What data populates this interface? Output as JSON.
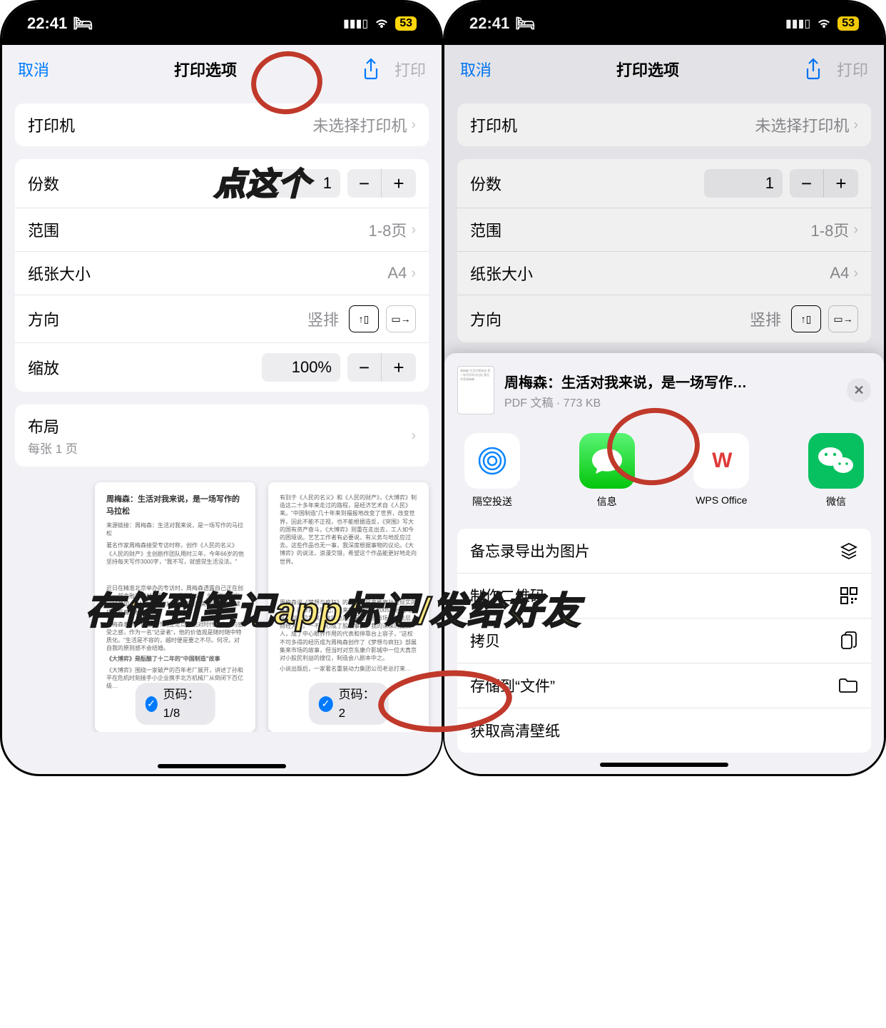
{
  "status": {
    "time": "22:41",
    "battery": "53"
  },
  "nav": {
    "cancel": "取消",
    "title": "打印选项",
    "print": "打印"
  },
  "rows": {
    "printer_label": "打印机",
    "printer_value": "未选择打印机",
    "copies_label": "份数",
    "copies_value": "1",
    "range_label": "范围",
    "range_value": "1-8页",
    "paper_label": "纸张大小",
    "paper_value": "A4",
    "orient_label": "方向",
    "orient_value": "竖排",
    "scale_label": "缩放",
    "scale_value": "100%",
    "layout_label": "布局",
    "layout_sub": "每张 1 页"
  },
  "preview": {
    "title": "周梅森：生活对我来说，是一场写作的马拉松",
    "sub1": "来源链接：周梅森：生活对我来说，是一场写作的马拉松",
    "badge1": "页码：1/8",
    "badge2": "页码：2"
  },
  "sheet": {
    "file_title": "周梅森：生活对我来说，是一场写作…",
    "file_type": "PDF 文稿",
    "file_size": "773 KB",
    "apps": {
      "airdrop": "隔空投送",
      "messages": "信息",
      "wps": "WPS Office",
      "wechat": "微信"
    },
    "actions": {
      "export_img": "备忘录导出为图片",
      "qr": "制作二维码",
      "copy": "拷贝",
      "save_files": "存储到“文件”",
      "wallpaper": "获取高清壁纸"
    }
  },
  "annotations": {
    "tap_this": "点这个",
    "big": "存储到笔记app标记/发给好友"
  }
}
